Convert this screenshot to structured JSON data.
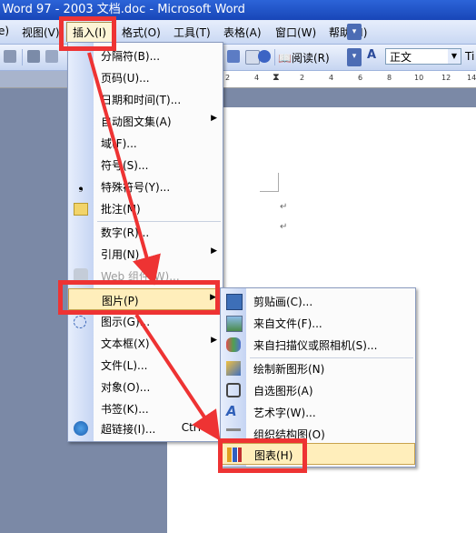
{
  "window": {
    "title": ": Word 97 - 2003 文档.doc - Microsoft Word"
  },
  "menubar": {
    "items": [
      {
        "label": "e)"
      },
      {
        "label": "视图(V)"
      },
      {
        "label": "插入(I)"
      },
      {
        "label": "格式(O)"
      },
      {
        "label": "工具(T)"
      },
      {
        "label": "表格(A)"
      },
      {
        "label": "窗口(W)"
      },
      {
        "label": "帮助(H)"
      }
    ]
  },
  "toolbar": {
    "reading_label": "阅读(R)",
    "style_icon_text": "A",
    "font_name": "正文",
    "font_name_partial": "Ti"
  },
  "ruler": {
    "numbers": [
      "2",
      "4",
      "2",
      "4",
      "6",
      "8",
      "10",
      "12",
      "14"
    ]
  },
  "document": {
    "paragraph_mark": "↵"
  },
  "insert_menu": {
    "items": [
      {
        "label": "分隔符(B)..."
      },
      {
        "label": "页码(U)..."
      },
      {
        "label": "日期和时间(T)..."
      },
      {
        "label": "自动图文集(A)"
      },
      {
        "label": "域(F)..."
      },
      {
        "label": "符号(S)..."
      },
      {
        "label": "特殊符号(Y)..."
      },
      {
        "label": "批注(M)"
      },
      {
        "label": "数字(R)..."
      },
      {
        "label": "引用(N)"
      },
      {
        "label": "Web 组件(W)..."
      },
      {
        "label": "图片(P)"
      },
      {
        "label": "图示(G)..."
      },
      {
        "label": "文本框(X)"
      },
      {
        "label": "文件(L)..."
      },
      {
        "label": "对象(O)..."
      },
      {
        "label": "书签(K)..."
      },
      {
        "label": "超链接(I)...",
        "shortcut": "Ctrl+K"
      }
    ]
  },
  "picture_submenu": {
    "items": [
      {
        "label": "剪贴画(C)..."
      },
      {
        "label": "来自文件(F)..."
      },
      {
        "label": "来自扫描仪或照相机(S)..."
      },
      {
        "label": "绘制新图形(N)"
      },
      {
        "label": "自选图形(A)"
      },
      {
        "label": "艺术字(W)..."
      },
      {
        "label": "组织结构图(O)"
      },
      {
        "label": "图表(H)"
      }
    ]
  },
  "colors": {
    "highlight": "#ee3333",
    "menu_hover": "#ffeebb"
  }
}
